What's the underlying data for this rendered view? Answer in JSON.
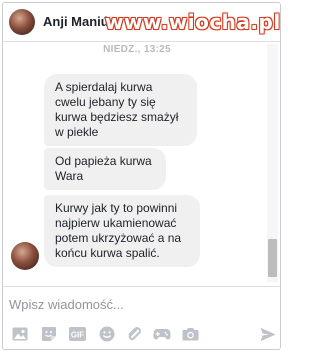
{
  "header": {
    "contact_name": "Anji Maniú",
    "watermark": "www.wiocha.pl"
  },
  "conversation": {
    "timestamp": "NIEDZ., 13:25",
    "messages": [
      {
        "text": "A spierdalaj kurwa cwelu jebany ty się kurwa będziesz smażył w piekle"
      },
      {
        "text": "Od papieża kurwa Wara"
      },
      {
        "text": "Kurwy jak ty to powinni najpierw ukamienować potem ukrzyżować a na końcu kurwa spalić."
      }
    ]
  },
  "composer": {
    "placeholder": "Wpisz wiadomość...",
    "icons": [
      "image-icon",
      "sticker-icon",
      "gif-icon",
      "emoji-icon",
      "attach-icon",
      "game-icon",
      "camera-icon",
      "send-icon"
    ]
  },
  "colors": {
    "bubble": "#f1f0f0",
    "icon": "#bec2c9",
    "watermark": "#d23b20"
  }
}
